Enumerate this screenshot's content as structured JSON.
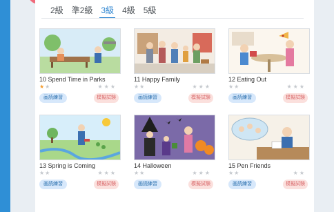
{
  "tabs": [
    "2級",
    "準2級",
    "3級",
    "4級",
    "5級"
  ],
  "active_tab": "3級",
  "cards": [
    {
      "title": "10 Spend Time in Parks",
      "rating_left": 1,
      "practice_label": "画読練習",
      "exam_label": "模擬試験"
    },
    {
      "title": "11 Happy Family",
      "rating_left": 0,
      "practice_label": "画読練習",
      "exam_label": "模擬試験"
    },
    {
      "title": "12 Eating Out",
      "rating_left": 0,
      "practice_label": "画読練習",
      "exam_label": "模擬試験"
    },
    {
      "title": "13 Spring is Coming",
      "rating_left": 0,
      "practice_label": "画読練習",
      "exam_label": "模擬試験"
    },
    {
      "title": "14 Halloween",
      "rating_left": 0,
      "practice_label": "画読練習",
      "exam_label": "模擬試験"
    },
    {
      "title": "15 Pen Friends",
      "rating_left": 0,
      "practice_label": "画読練習",
      "exam_label": "模擬試験"
    }
  ],
  "colors": {
    "accent": "#2f86d1",
    "star_on": "#f39b2d",
    "star_off": "#c4c8cd"
  },
  "icons": {
    "star": "star-icon"
  }
}
